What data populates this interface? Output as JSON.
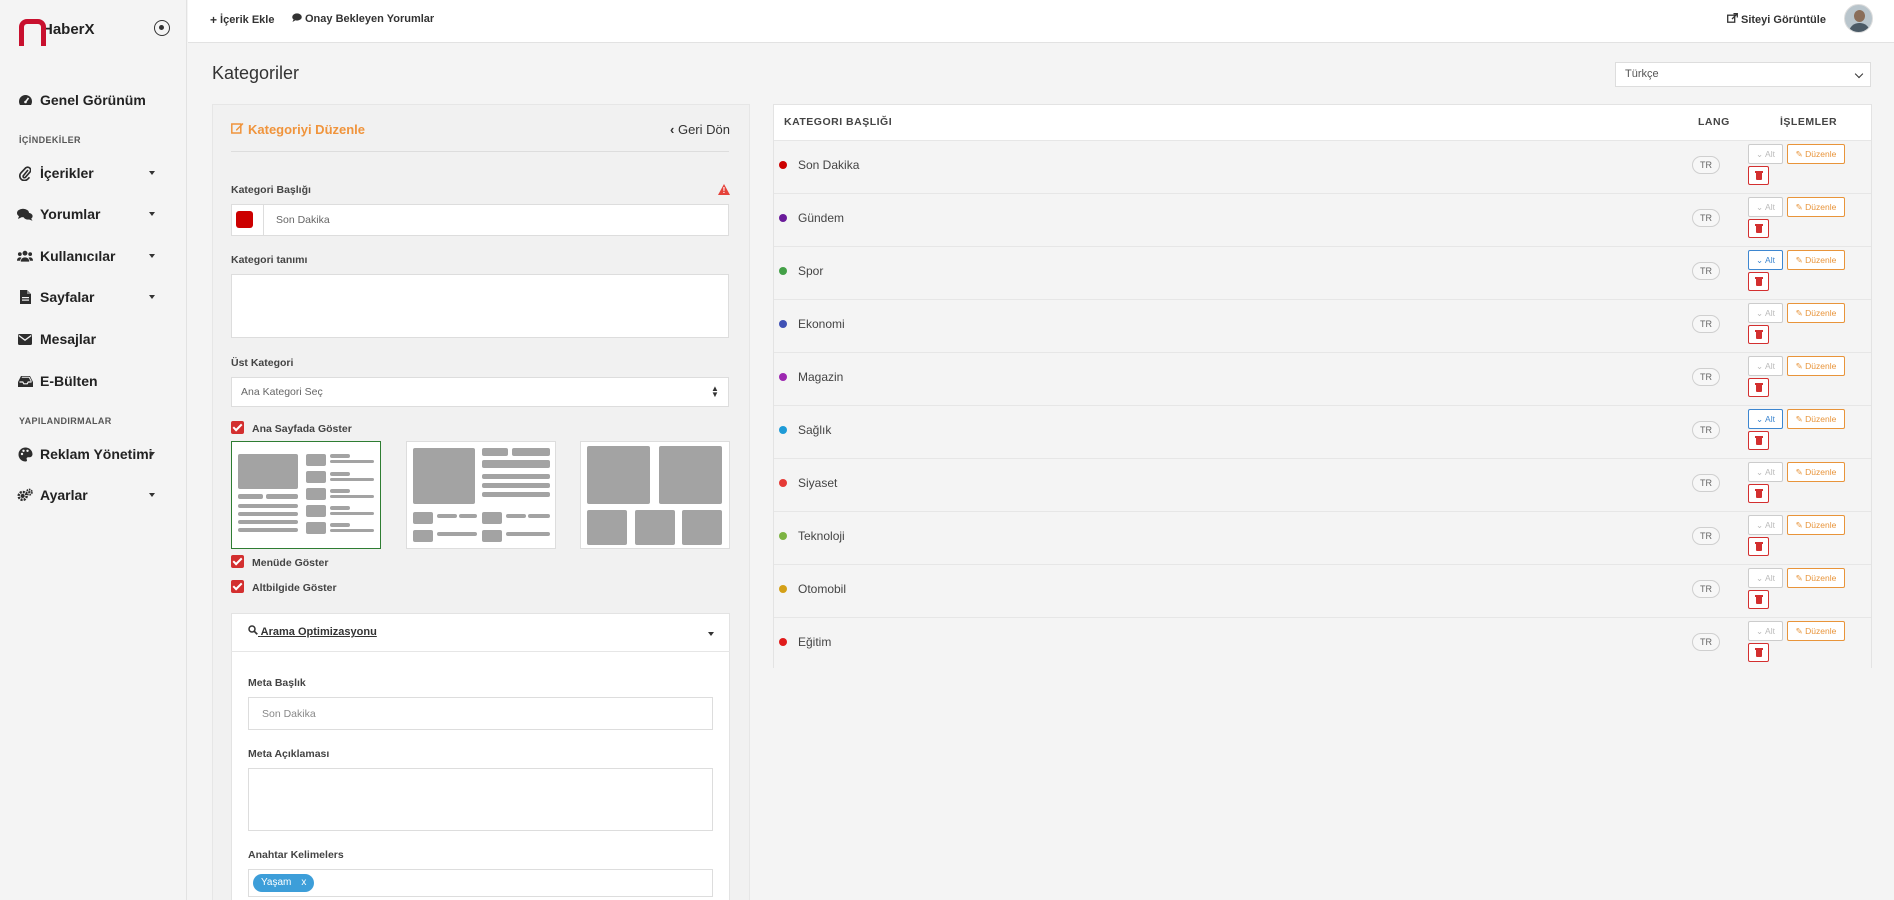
{
  "app": {
    "name": "HaberX"
  },
  "sidebar": {
    "items": [
      {
        "label": "Genel Görünüm",
        "icon": "dashboard-icon"
      },
      {
        "label": "İçerikler",
        "icon": "paperclip-icon"
      },
      {
        "label": "Yorumlar",
        "icon": "comments-icon"
      },
      {
        "label": "Kullanıcılar",
        "icon": "users-icon"
      },
      {
        "label": "Sayfalar",
        "icon": "file-icon"
      },
      {
        "label": "Mesajlar",
        "icon": "envelope-icon"
      },
      {
        "label": "E-Bülten",
        "icon": "inbox-icon"
      },
      {
        "label": "Reklam Yönetimi",
        "icon": "palette-icon"
      },
      {
        "label": "Ayarlar",
        "icon": "gears-icon"
      }
    ],
    "sections": {
      "contents": "İÇİNDEKİLER",
      "config": "YAPILANDIRMALAR"
    }
  },
  "topbar": {
    "add_content": "İçerik Ekle",
    "pending_comments": "Onay Bekleyen Yorumlar",
    "view_site": "Siteyi Görüntüle"
  },
  "page": {
    "title": "Kategoriler",
    "language": "Türkçe"
  },
  "form": {
    "title": "Kategoriyi Düzenle",
    "back": "Geri Dön",
    "category_title_label": "Kategori Başlığı",
    "category_title_value": "Son Dakika",
    "category_color": "#cc0000",
    "description_label": "Kategori tanımı",
    "parent_label": "Üst Kategori",
    "parent_value": "Ana Kategori Seç",
    "show_homepage": "Ana Sayfada Göster",
    "show_menu": "Menüde Göster",
    "show_footer": "Altbilgide Göster",
    "seo": {
      "title": "Arama Optimizasyonu",
      "meta_title_label": "Meta Başlık",
      "meta_title_placeholder": "Son Dakika",
      "meta_desc_label": "Meta Açıklaması",
      "keywords_label": "Anahtar Kelimelers",
      "keywords": [
        "Yaşam"
      ],
      "tag_remove": "x"
    }
  },
  "table": {
    "headers": {
      "title": "KATEGORI BAŞLIĞI",
      "lang": "LANG",
      "actions": "İŞLEMLER"
    },
    "btn_sub": "Alt",
    "btn_edit": "Düzenle",
    "rows": [
      {
        "name": "Son Dakika",
        "color": "#cc0000",
        "lang": "TR",
        "alt_active": false
      },
      {
        "name": "Gündem",
        "color": "#6a1b9a",
        "lang": "TR",
        "alt_active": false
      },
      {
        "name": "Spor",
        "color": "#43a047",
        "lang": "TR",
        "alt_active": true
      },
      {
        "name": "Ekonomi",
        "color": "#3f51b5",
        "lang": "TR",
        "alt_active": false
      },
      {
        "name": "Magazin",
        "color": "#9c27b0",
        "lang": "TR",
        "alt_active": false
      },
      {
        "name": "Sağlık",
        "color": "#1e9bd7",
        "lang": "TR",
        "alt_active": true
      },
      {
        "name": "Siyaset",
        "color": "#e53935",
        "lang": "TR",
        "alt_active": false
      },
      {
        "name": "Teknoloji",
        "color": "#7cb342",
        "lang": "TR",
        "alt_active": false
      },
      {
        "name": "Otomobil",
        "color": "#d4a017",
        "lang": "TR",
        "alt_active": false
      },
      {
        "name": "Eğitim",
        "color": "#e01b1b",
        "lang": "TR",
        "alt_active": false
      }
    ]
  }
}
